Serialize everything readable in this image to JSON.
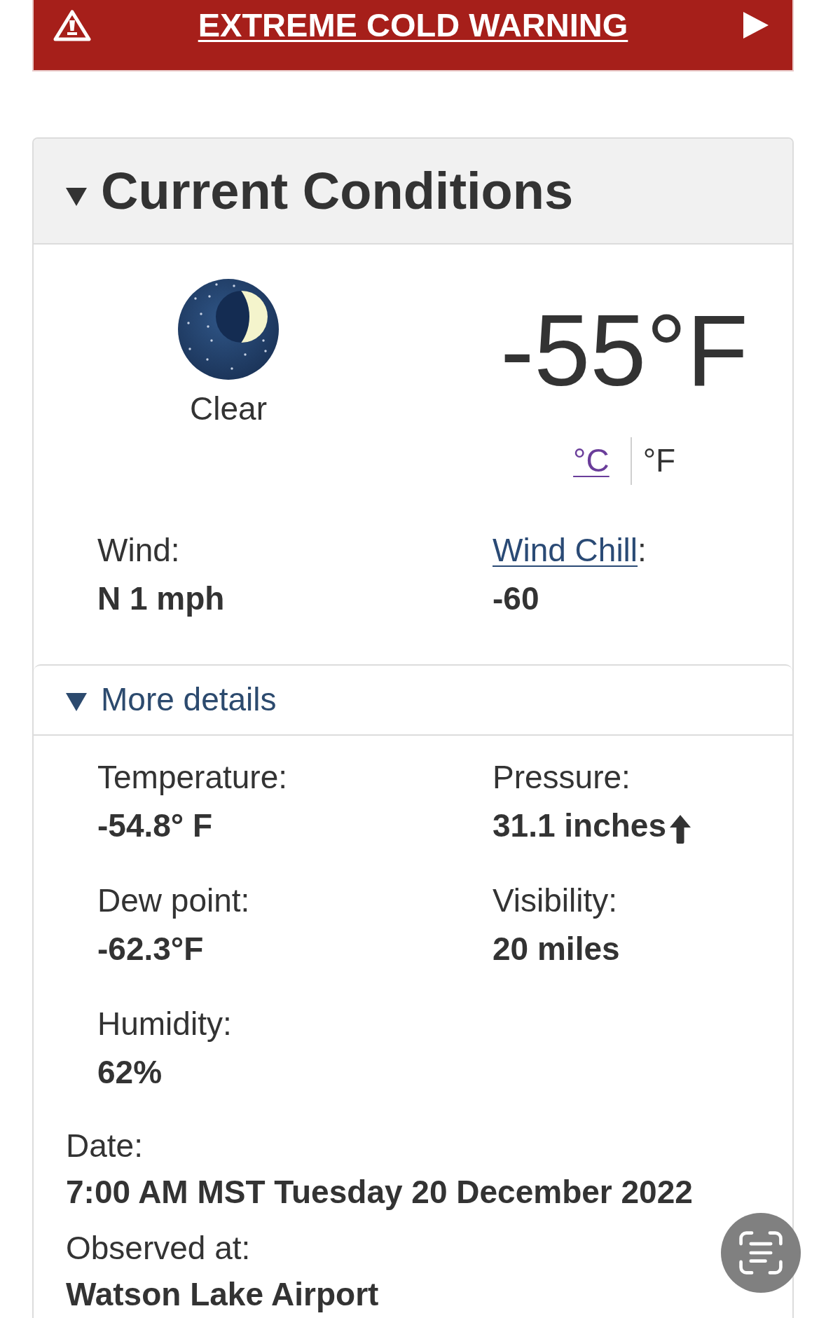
{
  "alert_banner": {
    "title": "EXTREME COLD WARNING"
  },
  "current_conditions": {
    "title": "Current Conditions",
    "expanded": true,
    "condition": "Clear",
    "temperature": "-55°F",
    "units": [
      {
        "label": "°C",
        "selected": false
      },
      {
        "label": "°F",
        "selected": true
      }
    ],
    "summary": [
      {
        "kind": "plain",
        "label": "Wind:",
        "value": "N 1 mph"
      },
      {
        "kind": "link",
        "label": "Wind Chill",
        "suffix": ":",
        "value": "-60"
      }
    ],
    "more_details": {
      "title": "More details",
      "expanded": true,
      "items": [
        {
          "label": "Temperature:",
          "value": "-54.8° F"
        },
        {
          "label": "Pressure:",
          "value": "31.1 inches",
          "rising": true
        },
        {
          "label": "Dew point:",
          "value": "-62.3°F"
        },
        {
          "label": "Visibility:",
          "value": "20 miles"
        },
        {
          "label": "Humidity:",
          "value": "62%"
        }
      ],
      "observation": [
        {
          "label": "Date:",
          "value": "7:00 AM MST Tuesday 20 December 2022"
        },
        {
          "label": "Observed at:",
          "value": "Watson Lake Airport"
        }
      ]
    }
  }
}
